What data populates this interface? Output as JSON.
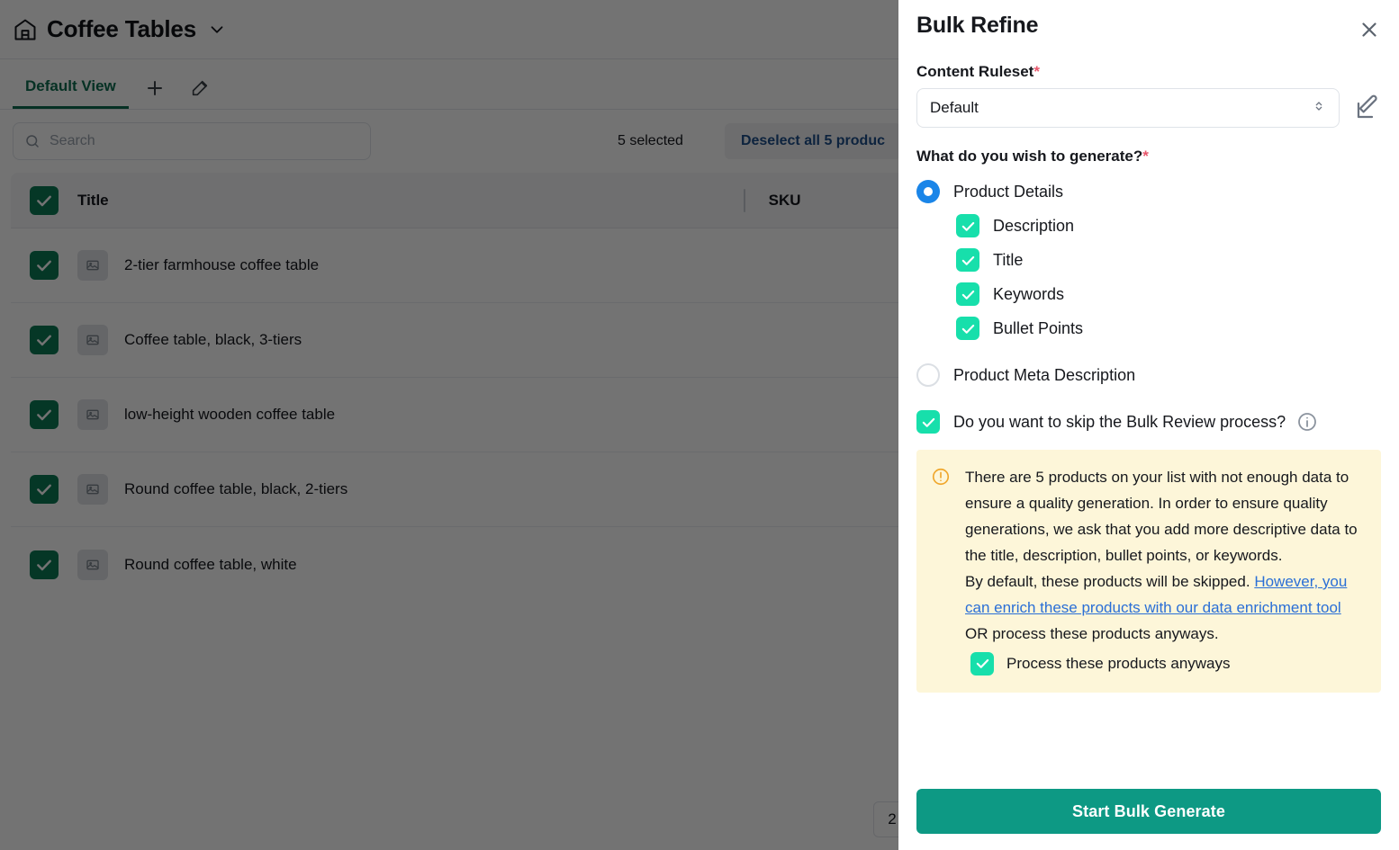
{
  "background": {
    "title": "Coffee Tables",
    "warehouse_icon": "warehouse-icon",
    "caret_icon": "chevron-down-icon",
    "tabs": {
      "default_view": "Default View",
      "add_icon": "plus-icon",
      "edit_icon": "edit-pencil-icon"
    },
    "search": {
      "placeholder": "Search",
      "icon": "search-icon"
    },
    "selection": {
      "count_label": "5 selected",
      "deselect_label": "Deselect all 5 produc"
    },
    "table": {
      "columns": [
        "Title",
        "SKU"
      ],
      "rows": [
        {
          "title": "2-tier farmhouse coffee table",
          "checked": true
        },
        {
          "title": "Coffee table, black, 3-tiers",
          "checked": true
        },
        {
          "title": "low-height wooden coffee table",
          "checked": true
        },
        {
          "title": "Round coffee table, black, 2-tiers",
          "checked": true
        },
        {
          "title": "Round coffee table, white",
          "checked": true
        }
      ]
    },
    "pagination": {
      "page": "2"
    }
  },
  "panel": {
    "title": "Bulk Refine",
    "close_icon": "close-icon",
    "ruleset": {
      "label": "Content Ruleset",
      "required_mark": "*",
      "value": "Default",
      "stepper_icon": "chevron-up-down-icon",
      "edit_icon": "edit-pencil-square-icon"
    },
    "generate_question": {
      "label": "What do you wish to generate?",
      "required_mark": "*"
    },
    "options": [
      {
        "label": "Product Details",
        "selected": true
      },
      {
        "label": "Product Meta Description",
        "selected": false
      }
    ],
    "product_detail_fields": [
      {
        "label": "Description",
        "checked": true
      },
      {
        "label": "Title",
        "checked": true
      },
      {
        "label": "Keywords",
        "checked": true
      },
      {
        "label": "Bullet Points",
        "checked": true
      }
    ],
    "skip_review": {
      "label": "Do you want to skip the Bulk Review process?",
      "checked": true,
      "info_icon": "info-circle-icon"
    },
    "warning": {
      "icon": "alert-circle-icon",
      "paragraph_1": "There are 5 products on your list with not enough data to ensure a quality generation. In order to ensure quality generations, we ask that you add more descriptive data to the title, description, bullet points, or keywords.",
      "paragraph_2_lead": "By default, these products will be skipped.",
      "link_text": "However, you can enrich these products with our data enrichment tool",
      "paragraph_2_tail": " OR process these products anyways.",
      "process_anyways_label": "Process these products anyways",
      "process_anyways_checked": true
    },
    "submit_label": "Start Bulk Generate"
  },
  "colors": {
    "brand_green": "#0d9984",
    "tab_green": "#0e6e50",
    "mint_check": "#17dfab",
    "radio_blue": "#1a85e8",
    "link_blue": "#2a6fd6",
    "required_red": "#e8566b",
    "warning_bg": "#fdf6d9",
    "warning_icon": "#f0a72c",
    "row_check_green": "#0d7a56"
  }
}
